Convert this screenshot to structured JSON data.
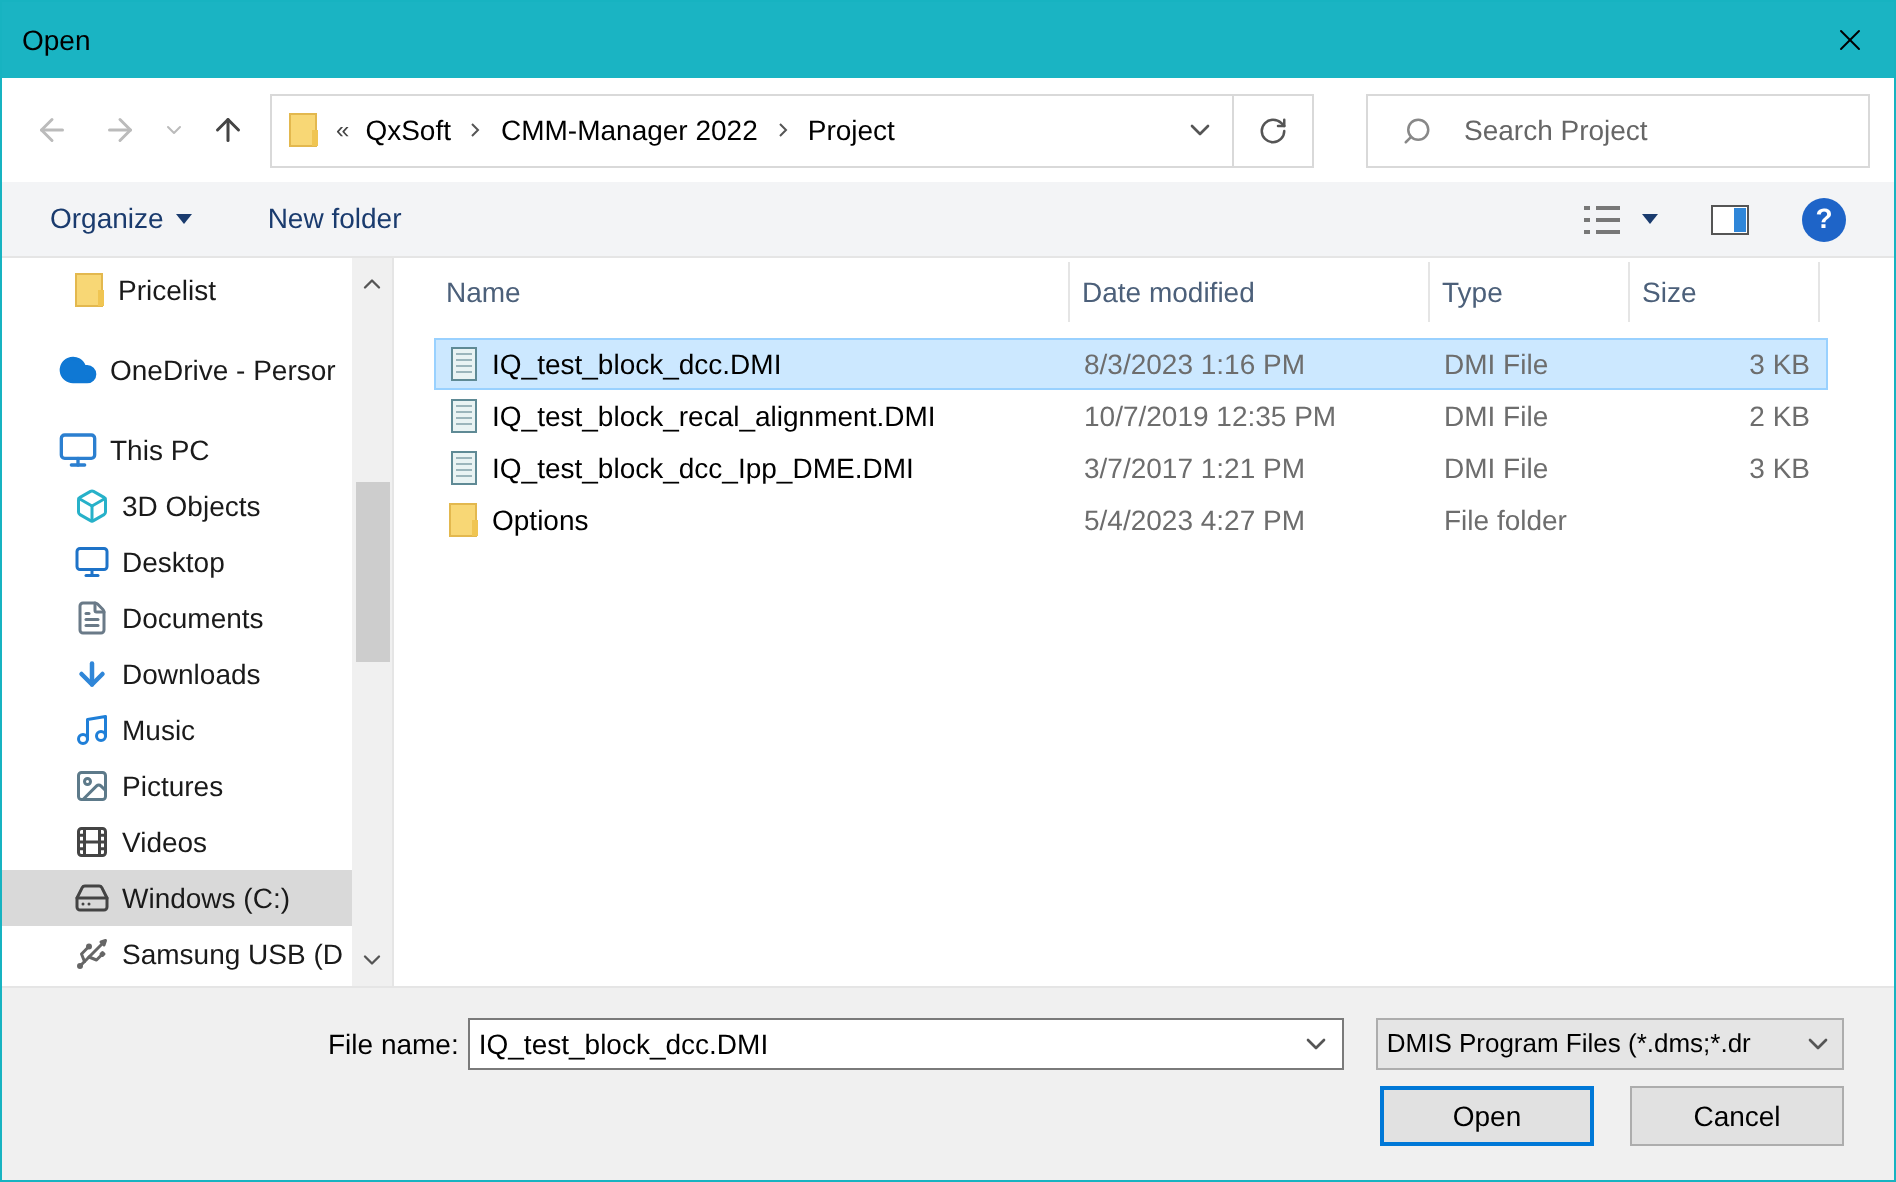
{
  "window": {
    "title": "Open"
  },
  "breadcrumb": {
    "overflow": "«",
    "segments": [
      "QxSoft",
      "CMM-Manager 2022",
      "Project"
    ]
  },
  "search": {
    "placeholder": "Search Project"
  },
  "toolbar": {
    "organize": "Organize",
    "new_folder": "New folder",
    "help": "?"
  },
  "sidebar": {
    "quick_access_items": [
      {
        "label": "Pricelist",
        "kind": "folder",
        "selected": false
      }
    ],
    "items": [
      {
        "label": "OneDrive - Persor",
        "kind": "cloud",
        "selected": false
      },
      {
        "label": "This PC",
        "kind": "pc",
        "selected": false,
        "children": [
          {
            "label": "3D Objects",
            "kind": "cube",
            "selected": false
          },
          {
            "label": "Desktop",
            "kind": "desktop",
            "selected": false
          },
          {
            "label": "Documents",
            "kind": "documents",
            "selected": false
          },
          {
            "label": "Downloads",
            "kind": "downloads",
            "selected": false
          },
          {
            "label": "Music",
            "kind": "music",
            "selected": false
          },
          {
            "label": "Pictures",
            "kind": "pictures",
            "selected": false
          },
          {
            "label": "Videos",
            "kind": "videos",
            "selected": false
          },
          {
            "label": "Windows (C:)",
            "kind": "drive",
            "selected": true
          },
          {
            "label": "Samsung USB (D",
            "kind": "usb",
            "selected": false
          }
        ]
      }
    ]
  },
  "table": {
    "columns": [
      "Name",
      "Date modified",
      "Type",
      "Size"
    ],
    "rows": [
      {
        "name": "IQ_test_block_dcc.DMI",
        "date": "8/3/2023 1:16 PM",
        "type": "DMI File",
        "size": "3 KB",
        "kind": "file",
        "selected": true
      },
      {
        "name": "IQ_test_block_recal_alignment.DMI",
        "date": "10/7/2019 12:35 PM",
        "type": "DMI File",
        "size": "2 KB",
        "kind": "file",
        "selected": false
      },
      {
        "name": "IQ_test_block_dcc_Ipp_DME.DMI",
        "date": "3/7/2017 1:21 PM",
        "type": "DMI File",
        "size": "3 KB",
        "kind": "file",
        "selected": false
      },
      {
        "name": "Options",
        "date": "5/4/2023 4:27 PM",
        "type": "File folder",
        "size": "",
        "kind": "folder",
        "selected": false
      }
    ]
  },
  "footer": {
    "file_name_label": "File name:",
    "file_name_value": "IQ_test_block_dcc.DMI",
    "file_type": "DMIS Program Files (*.dms;*.dr",
    "open": "Open",
    "cancel": "Cancel"
  }
}
